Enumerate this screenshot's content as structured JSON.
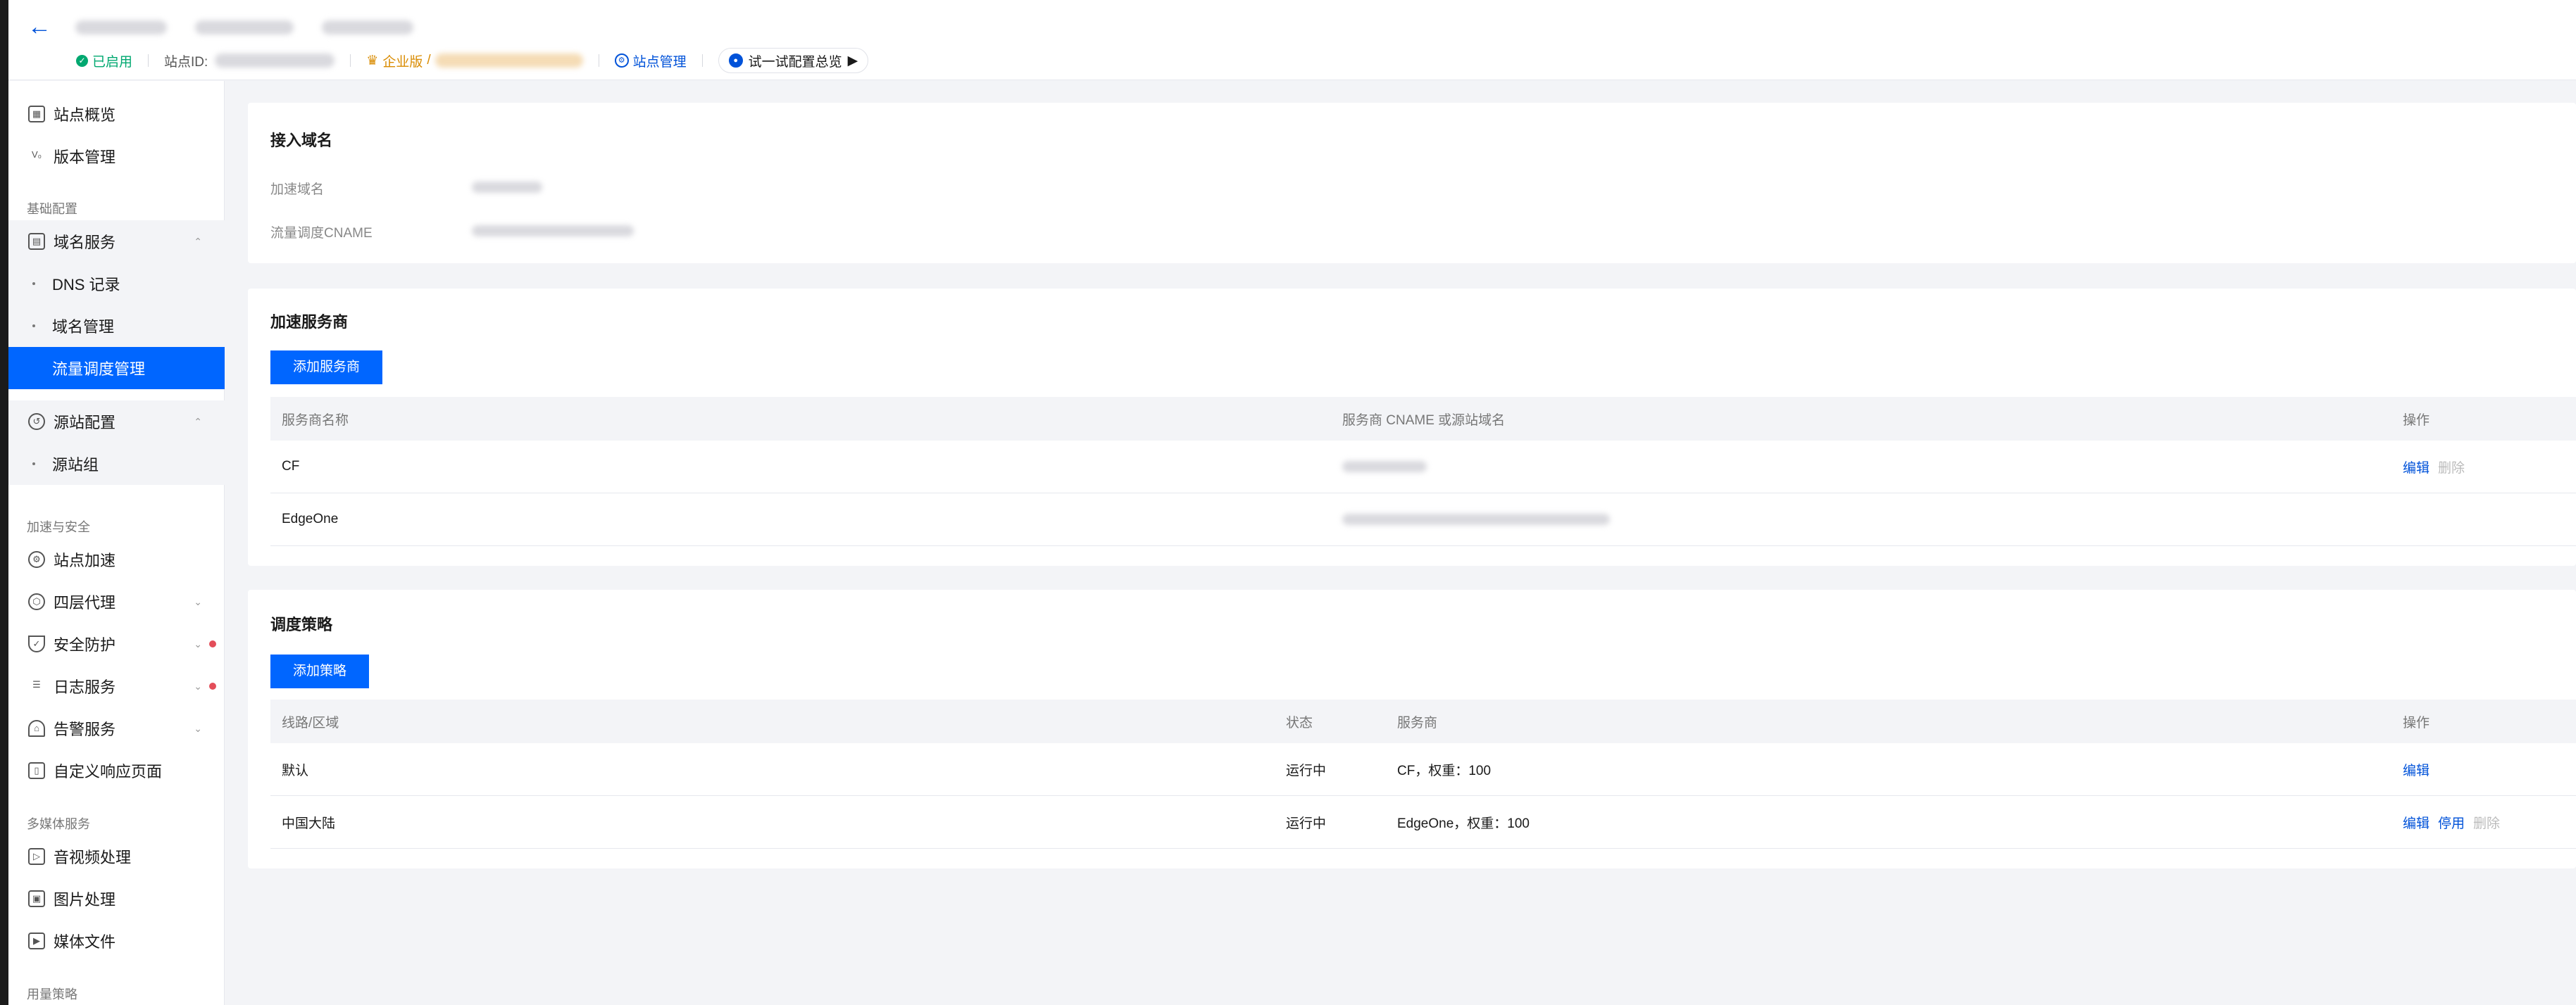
{
  "topbar": {
    "status": "已启用",
    "site_id_label": "站点ID:",
    "edition": "企业版",
    "edition_sep": "/",
    "site_manage": "站点管理",
    "try_config": "试一试配置总览"
  },
  "sidebar": {
    "overview": "站点概览",
    "version": "版本管理",
    "group_basic": "基础配置",
    "domain_service": "域名服务",
    "dns_record": "DNS 记录",
    "domain_manage": "域名管理",
    "traffic_manage": "流量调度管理",
    "origin_config": "源站配置",
    "origin_group": "源站组",
    "group_accel": "加速与安全",
    "site_accel": "站点加速",
    "l4_proxy": "四层代理",
    "security": "安全防护",
    "log_service": "日志服务",
    "alarm_service": "告警服务",
    "custom_page": "自定义响应页面",
    "group_media": "多媒体服务",
    "av_process": "音视频处理",
    "image_process": "图片处理",
    "media_file": "媒体文件",
    "group_usage": "用量策略"
  },
  "access_domain": {
    "title": "接入域名",
    "accel_domain_label": "加速域名",
    "cname_label": "流量调度CNAME"
  },
  "providers": {
    "title": "加速服务商",
    "add_button": "添加服务商",
    "columns": [
      "服务商名称",
      "服务商 CNAME 或源站域名",
      "操作"
    ],
    "rows": [
      {
        "name": "CF",
        "edit": "编辑",
        "delete": "删除"
      },
      {
        "name": "EdgeOne"
      }
    ]
  },
  "strategy": {
    "title": "调度策略",
    "add_button": "添加策略",
    "columns": [
      "线路/区域",
      "状态",
      "服务商",
      "操作"
    ],
    "rows": [
      {
        "region": "默认",
        "status": "运行中",
        "provider": "CF，权重：100",
        "edit": "编辑"
      },
      {
        "region": "中国大陆",
        "status": "运行中",
        "provider": "EdgeOne，权重：100",
        "edit": "编辑",
        "disable": "停用",
        "delete": "删除"
      }
    ]
  }
}
